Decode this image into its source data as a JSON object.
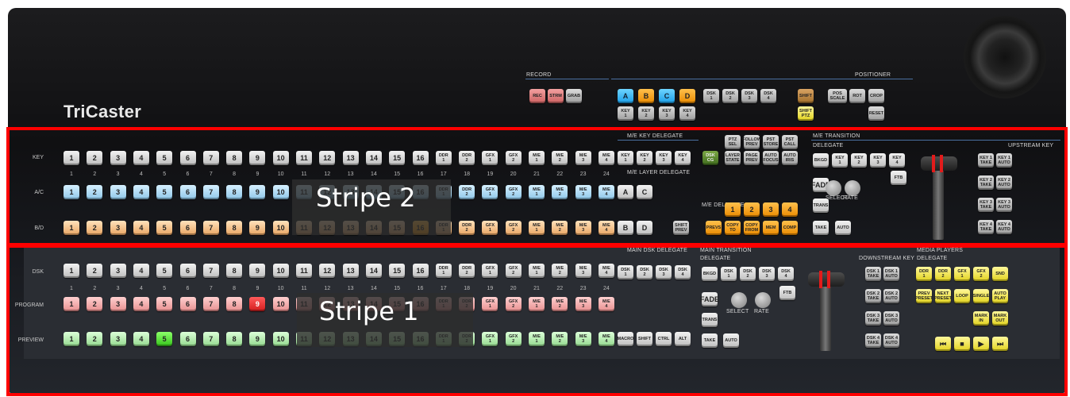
{
  "brand": "TriCaster",
  "record": {
    "label": "RECORD",
    "buttons": [
      "REC",
      "STRM",
      "GRAB"
    ]
  },
  "positioner": {
    "label": "POSITIONER",
    "abcd": [
      "A",
      "B",
      "C",
      "D"
    ],
    "keys": [
      "KEY\n1",
      "KEY\n2",
      "KEY\n3",
      "KEY\n4"
    ],
    "dsk": [
      "DSK\n1",
      "DSK\n2",
      "DSK\n3",
      "DSK\n4"
    ],
    "shift": "SHIFT",
    "shift_ptz": "SHIFT\nPTZ",
    "pos_scale": "POS\nSCALE",
    "rot": "ROT",
    "crop": "CROP",
    "reset": "RESET"
  },
  "me_key_delegate": {
    "label": "M/E KEY DELEGATE",
    "buttons": [
      "KEY\n1",
      "KEY\n2",
      "KEY\n3",
      "KEY\n4"
    ]
  },
  "me_layer_delegate": {
    "label": "M/E LAYER DELEGATE",
    "buttons": [
      "A",
      "C"
    ],
    "bd": [
      "B",
      "D"
    ],
    "shift_prev": "SHIFT\nPREV"
  },
  "source_buttons": [
    "1",
    "2",
    "3",
    "4",
    "5",
    "6",
    "7",
    "8",
    "9",
    "10",
    "11",
    "12",
    "13",
    "14",
    "15",
    "16",
    "DDR\n1",
    "DDR\n2",
    "GFX\n1",
    "GFX\n2",
    "M/E\n1",
    "M/E\n2",
    "M/E\n3",
    "M/E\n4"
  ],
  "source_numbers": [
    "1",
    "2",
    "3",
    "4",
    "5",
    "6",
    "7",
    "8",
    "9",
    "10",
    "11",
    "12",
    "13",
    "14",
    "15",
    "16",
    "17",
    "18",
    "19",
    "20",
    "21",
    "22",
    "23",
    "24"
  ],
  "rows_top": {
    "key": "KEY",
    "ac": "A/C",
    "bd": "B/D"
  },
  "rows_bottom": {
    "dsk": "DSK",
    "program": "PROGRAM",
    "preview": "PREVIEW"
  },
  "misc_top": {
    "grid1": [
      "PTZ\nSEL",
      "FOLLOW\nPREV",
      "PST\nSTORE",
      "PST\nCALL"
    ],
    "grid2": [
      "LAYER\nSTATE",
      "PAGE\nPREV",
      "AUTO\nFOCUS",
      "AUTO\nIRIS"
    ],
    "dsk_cg": "DSK\nCG",
    "me_delegate": "M/E\nDELEGATE",
    "delegate_nums": [
      "1",
      "2",
      "3",
      "4"
    ],
    "bottom": [
      "PREVS",
      "COPY\nTO",
      "COPY\nFROM",
      "MEM",
      "COMP"
    ]
  },
  "me_transition": {
    "label": "M/E TRANSITION",
    "delegate": "DELEGATE",
    "buttons": [
      "BKGD",
      "KEY\n1",
      "KEY\n2",
      "KEY\n3",
      "KEY\n4"
    ],
    "fade": "FADE",
    "trans": "TRANS",
    "ftb": "FTB",
    "select": "SELECT",
    "rate": "RATE",
    "take": "TAKE",
    "auto": "AUTO"
  },
  "upstream_key": {
    "label": "UPSTREAM KEY",
    "buttons": [
      "KEY 1\nTAKE",
      "KEY 1\nAUTO",
      "KEY 2\nTAKE",
      "KEY 2\nAUTO",
      "KEY 3\nTAKE",
      "KEY 3\nAUTO",
      "KEY 4\nTAKE",
      "KEY 4\nAUTO"
    ]
  },
  "main_dsk_delegate": {
    "label": "MAIN DSK DELEGATE",
    "buttons": [
      "DSK\n1",
      "DSK\n2",
      "DSK\n3",
      "DSK\n4"
    ]
  },
  "preview_extra": [
    "MACRO",
    "SHIFT",
    "CTRL",
    "ALT"
  ],
  "main_transition": {
    "label": "MAIN TRANSITION",
    "delegate": "DELEGATE",
    "buttons": [
      "BKGD",
      "DSK\n1",
      "DSK\n2",
      "DSK\n3",
      "DSK\n4"
    ],
    "fade": "FADE",
    "trans": "TRANS",
    "ftb": "FTB",
    "select": "SELECT",
    "rate": "RATE",
    "take": "TAKE",
    "auto": "AUTO"
  },
  "downstream_key": {
    "label": "DOWNSTREAM KEY",
    "buttons": [
      "DSK 1\nTAKE",
      "DSK 1\nAUTO",
      "DSK 2\nTAKE",
      "DSK 2\nAUTO",
      "DSK 3\nTAKE",
      "DSK 3\nAUTO",
      "DSK 4\nTAKE",
      "DSK 4\nAUTO"
    ]
  },
  "media_players": {
    "label": "MEDIA PLAYERS",
    "delegate": "DELEGATE",
    "row1": [
      "DDR\n1",
      "DDR\n2",
      "GFX\n1",
      "GFX\n2",
      "SND"
    ],
    "row2": [
      "PREV\nPRESET",
      "NEXT\nPRESET",
      "LOOP",
      "SINGLE",
      "AUTO\nPLAY"
    ],
    "row3": [
      "MARK\nIN",
      "MARK\nOUT"
    ],
    "transport": [
      "rewind-icon",
      "stop-icon",
      "play-icon",
      "forward-icon"
    ]
  },
  "overlays": {
    "stripe2": "Stripe  2",
    "stripe1": "Stripe  1"
  },
  "colors": {
    "highlight": "#ff0000",
    "accent_line": "#4a6fa0"
  }
}
